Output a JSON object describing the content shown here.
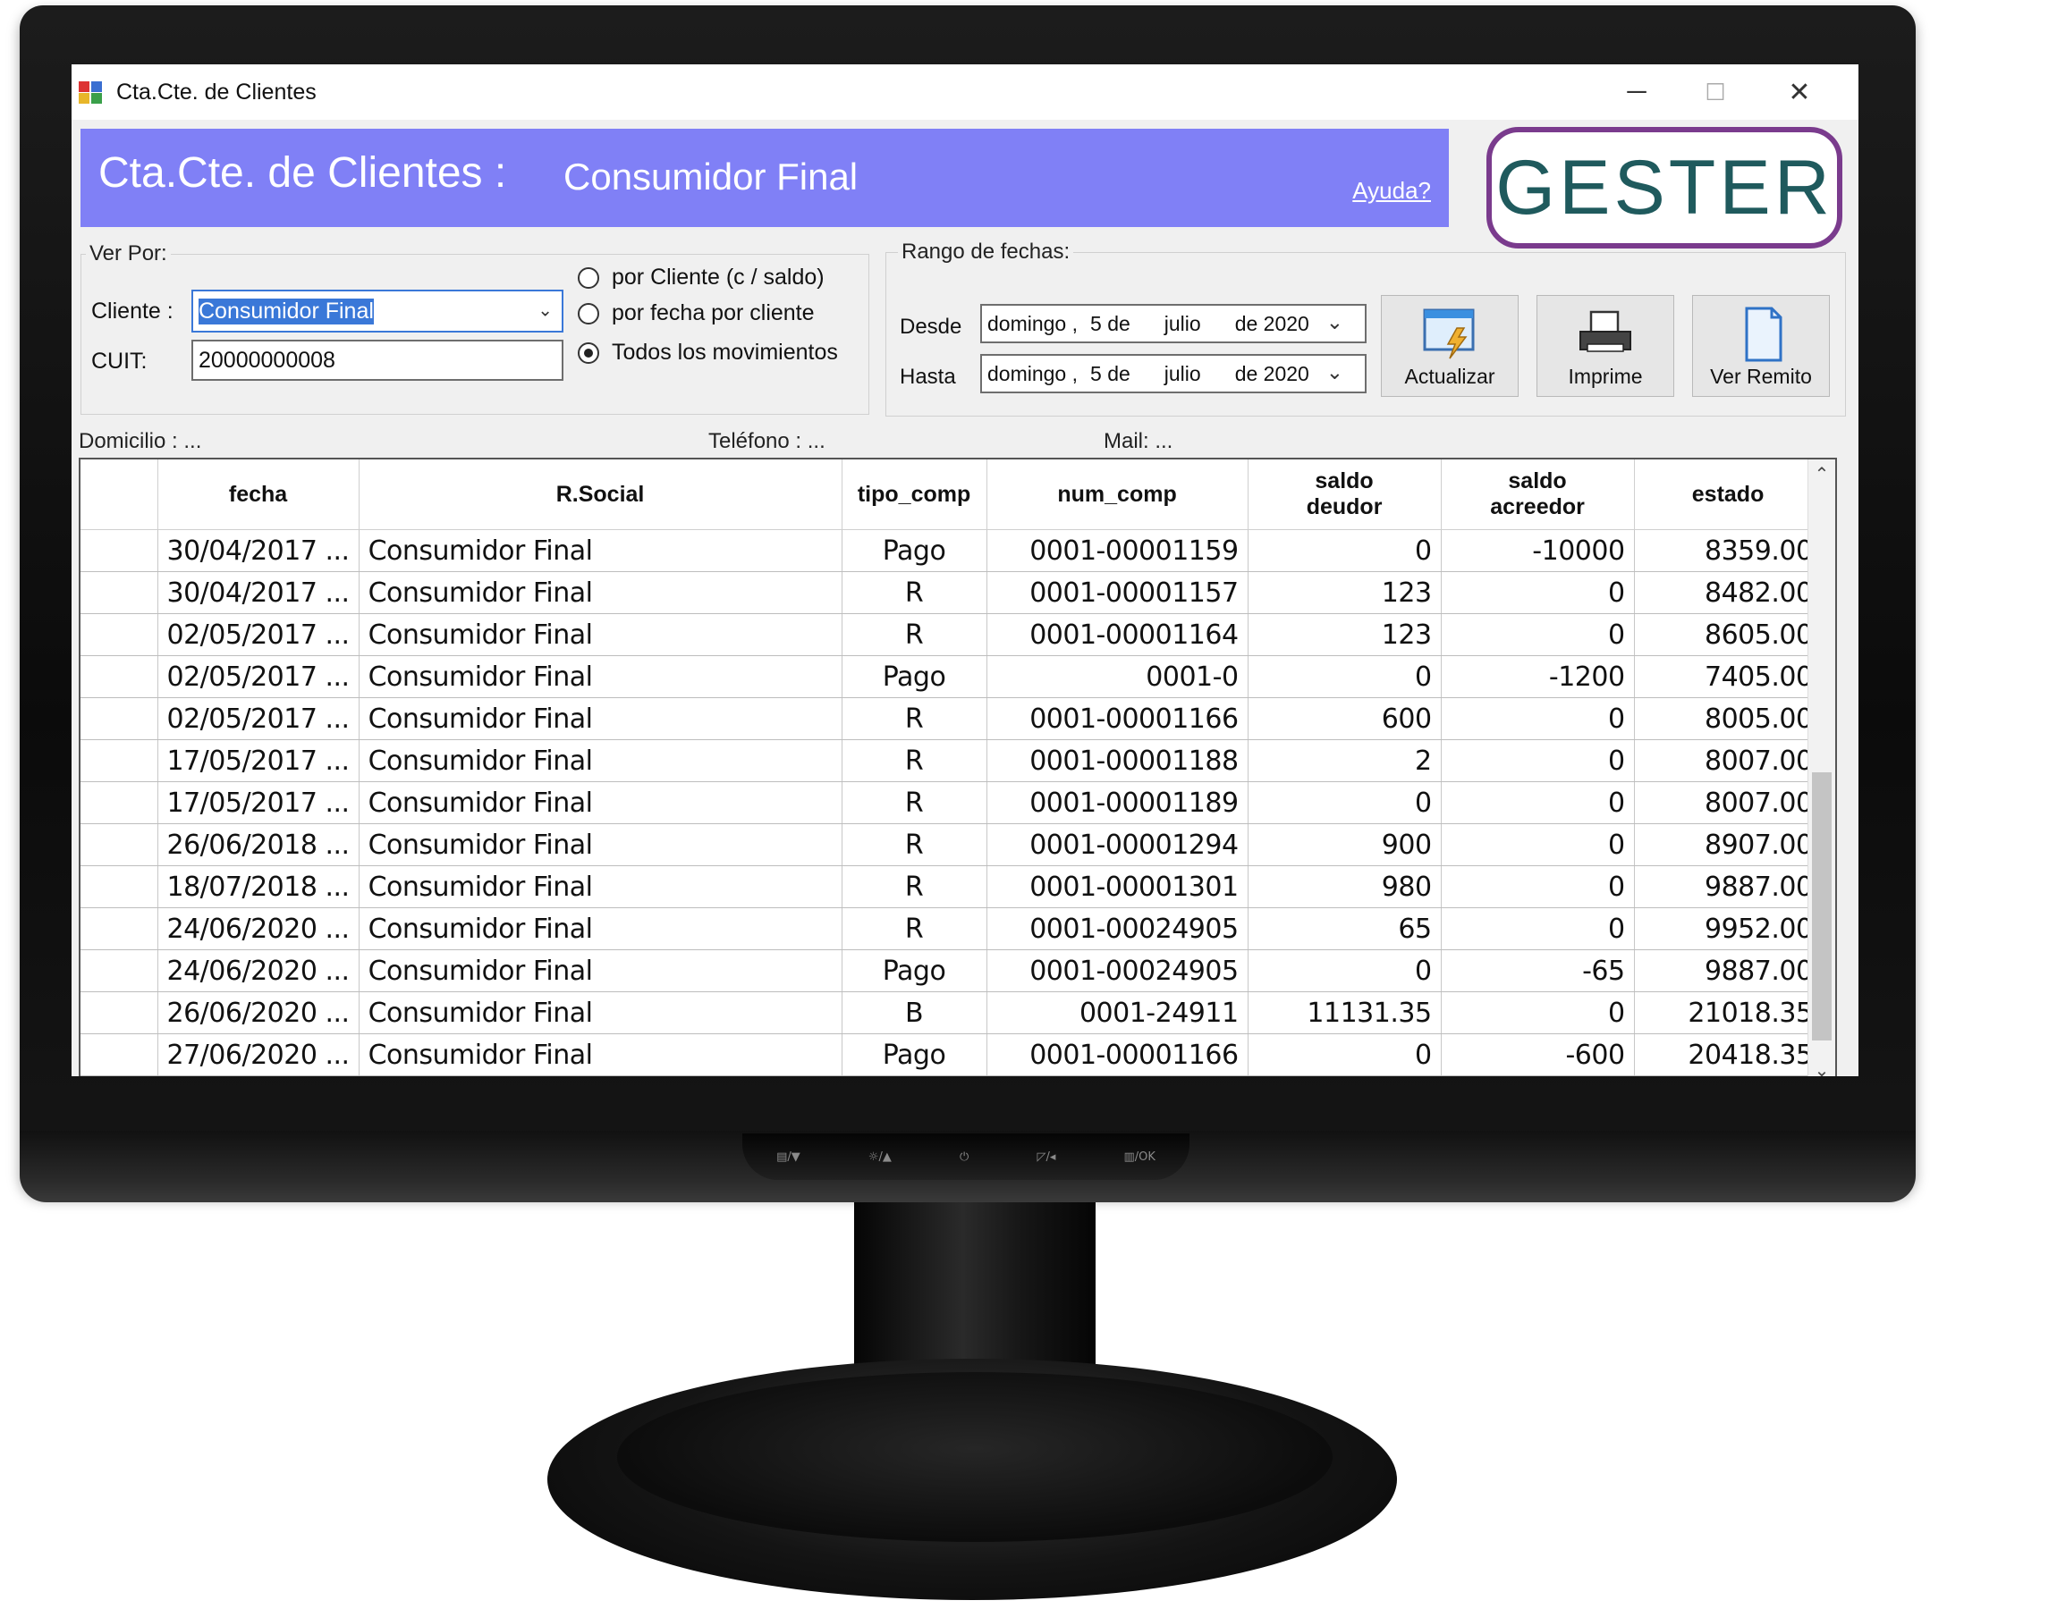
{
  "window": {
    "title": "Cta.Cte. de Clientes",
    "minimize": "─",
    "maximize": "☐",
    "close": "✕"
  },
  "header": {
    "title": "Cta.Cte. de Clientes :",
    "subtitle": "Consumidor Final",
    "help": "Ayuda?",
    "logo": "GESTER",
    "logo_color": "#1f5a5d",
    "logo_border_color": "#7a3b8d",
    "banner_color": "#8080f6"
  },
  "ver_por": {
    "group_label": "Ver Por:",
    "cliente_label": "Cliente :",
    "cliente_value": "Consumidor Final",
    "cuit_label": "CUIT:",
    "cuit_value": "20000000008",
    "radios": [
      {
        "label": "por Cliente (c / saldo)",
        "selected": false
      },
      {
        "label": "por fecha por cliente",
        "selected": false
      },
      {
        "label": "Todos los movimientos",
        "selected": true
      }
    ]
  },
  "rango": {
    "group_label": "Rango de fechas:",
    "desde_label": "Desde",
    "hasta_label": "Hasta",
    "desde": {
      "weekday": "domingo ,",
      "day": "5 de",
      "month": "julio",
      "year": "de 2020"
    },
    "hasta": {
      "weekday": "domingo ,",
      "day": "5 de",
      "month": "julio",
      "year": "de 2020"
    }
  },
  "toolbar": {
    "actualizar": "Actualizar",
    "imprime": "Imprime",
    "ver_remito": "Ver Remito"
  },
  "info": {
    "domicilio": "Domicilio :     ...",
    "telefono": "Teléfono :  ...",
    "mail": "Mail:  ..."
  },
  "table": {
    "headers": [
      "",
      "fecha",
      "R.Social",
      "tipo_comp",
      "num_comp",
      "saldo\ndeudor",
      "saldo\nacreedor",
      "estado"
    ],
    "header_saldo_deudor_1": "saldo",
    "header_saldo_deudor_2": "deudor",
    "header_saldo_acreedor_1": "saldo",
    "header_saldo_acreedor_2": "acreedor",
    "rows": [
      [
        "30/04/2017 ...",
        "Consumidor Final",
        "Pago",
        "0001-00001159",
        "0",
        "-10000",
        "8359.00"
      ],
      [
        "30/04/2017 ...",
        "Consumidor Final",
        "R",
        "0001-00001157",
        "123",
        "0",
        "8482.00"
      ],
      [
        "02/05/2017 ...",
        "Consumidor Final",
        "R",
        "0001-00001164",
        "123",
        "0",
        "8605.00"
      ],
      [
        "02/05/2017 ...",
        "Consumidor Final",
        "Pago",
        "0001-0",
        "0",
        "-1200",
        "7405.00"
      ],
      [
        "02/05/2017 ...",
        "Consumidor Final",
        "R",
        "0001-00001166",
        "600",
        "0",
        "8005.00"
      ],
      [
        "17/05/2017 ...",
        "Consumidor Final",
        "R",
        "0001-00001188",
        "2",
        "0",
        "8007.00"
      ],
      [
        "17/05/2017 ...",
        "Consumidor Final",
        "R",
        "0001-00001189",
        "0",
        "0",
        "8007.00"
      ],
      [
        "26/06/2018 ...",
        "Consumidor Final",
        "R",
        "0001-00001294",
        "900",
        "0",
        "8907.00"
      ],
      [
        "18/07/2018 ...",
        "Consumidor Final",
        "R",
        "0001-00001301",
        "980",
        "0",
        "9887.00"
      ],
      [
        "24/06/2020 ...",
        "Consumidor Final",
        "R",
        "0001-00024905",
        "65",
        "0",
        "9952.00"
      ],
      [
        "24/06/2020 ...",
        "Consumidor Final",
        "Pago",
        "0001-00024905",
        "0",
        "-65",
        "9887.00"
      ],
      [
        "26/06/2020 ...",
        "Consumidor Final",
        "B",
        "0001-24911",
        "11131.35",
        "0",
        "21018.35"
      ],
      [
        "27/06/2020 ...",
        "Consumidor Final",
        "Pago",
        "0001-00001166",
        "0",
        "-600",
        "20418.35"
      ]
    ]
  },
  "monitor": {
    "controls": [
      "▤/▼",
      "☼/▲",
      "⏻",
      "◸/◂",
      "▥/OK"
    ]
  }
}
